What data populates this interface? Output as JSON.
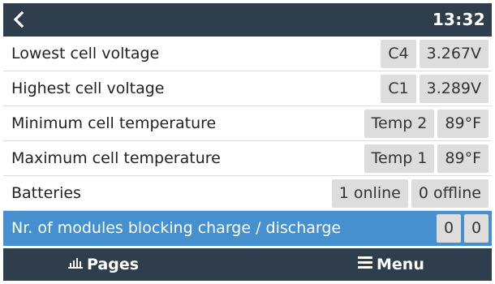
{
  "header": {
    "back_icon": "chevron-left-icon",
    "time": "13:32"
  },
  "rows": [
    {
      "label": "Lowest cell voltage",
      "values": [
        "C4",
        "3.267V"
      ]
    },
    {
      "label": "Highest cell voltage",
      "values": [
        "C1",
        "3.289V"
      ]
    },
    {
      "label": "Minimum cell temperature",
      "values": [
        "Temp 2",
        "89°F"
      ]
    },
    {
      "label": "Maximum cell temperature",
      "values": [
        "Temp 1",
        "89°F"
      ]
    },
    {
      "label": "Batteries",
      "values": [
        "1 online",
        "0 offline"
      ]
    },
    {
      "label": "Nr. of modules blocking charge / discharge",
      "values": [
        "0",
        "0"
      ],
      "selected": true
    }
  ],
  "footer": {
    "pages_label": "Pages",
    "pages_icon": "bar-chart-icon",
    "menu_label": "Menu",
    "menu_icon": "hamburger-menu-icon"
  },
  "colors": {
    "bar_background": "#2f3e4c",
    "selection": "#4790d0",
    "value_box": "#dddddd"
  }
}
